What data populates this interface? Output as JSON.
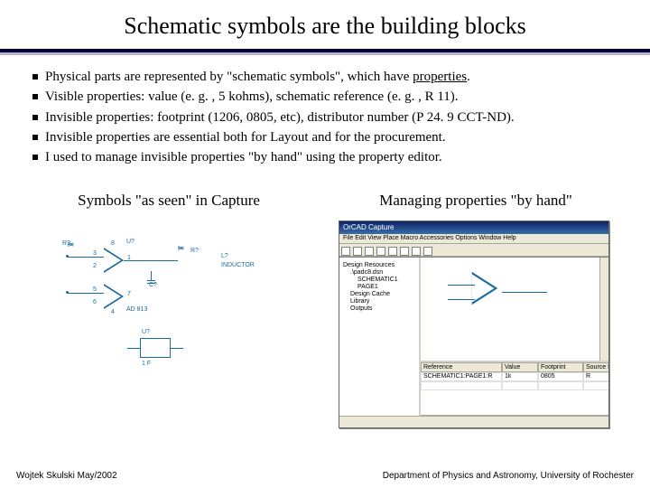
{
  "title": "Schematic symbols are the building blocks",
  "bullets": [
    {
      "pre": "Physical parts are represented by \"schematic symbols\", which have ",
      "u": "properties",
      "post": "."
    },
    {
      "pre": "Visible properties: value (e. g. , 5 kohms), schematic reference (e. g. , R 11).",
      "u": "",
      "post": ""
    },
    {
      "pre": "Invisible properties: footprint (1206, 0805, etc), distributor number (P 24. 9 CCT-ND).",
      "u": "",
      "post": ""
    },
    {
      "pre": "Invisible properties are essential both for Layout and for the procurement.",
      "u": "",
      "post": ""
    },
    {
      "pre": "I used to manage invisible properties \"by hand\" using the property editor.",
      "u": "",
      "post": ""
    }
  ],
  "caption_left": "Symbols \"as seen\" in Capture",
  "caption_right": "Managing properties \"by hand\"",
  "schematic": {
    "l1": "L?",
    "l2": "INDUCTOR",
    "u1": "U?",
    "part": "AD 813",
    "u2": "U?",
    "cap": "1 F",
    "r1": "R?",
    "r2": "R?",
    "c1": "C?",
    "pin3": "3",
    "pin2": "2",
    "pin5": "5",
    "pin6": "6",
    "pin8": "8",
    "pin1": "1",
    "pin7": "7",
    "pin4": "4"
  },
  "editor": {
    "title": "OrCAD Capture",
    "menu": "File  Edit  View  Place  Macro  Accessories  Options  Window  Help",
    "tree": {
      "root": "Design Resources",
      "a": ".\\padc8.dsn",
      "b": "SCHEMATIC1",
      "c": "PAGE1",
      "d": "Design Cache",
      "e": "Library",
      "f": "Outputs"
    },
    "grid": {
      "h1": "Reference",
      "h2": "Value",
      "h3": "Footprint",
      "h4": "Source Part",
      "r1c1": "SCHEMATIC1:PAGE1:R",
      "r1c2": "1k",
      "r1c3": "0805",
      "r1c4": "R"
    }
  },
  "footer_left": "Wojtek Skulski May/2002",
  "footer_right": "Department of Physics and Astronomy, University of Rochester"
}
